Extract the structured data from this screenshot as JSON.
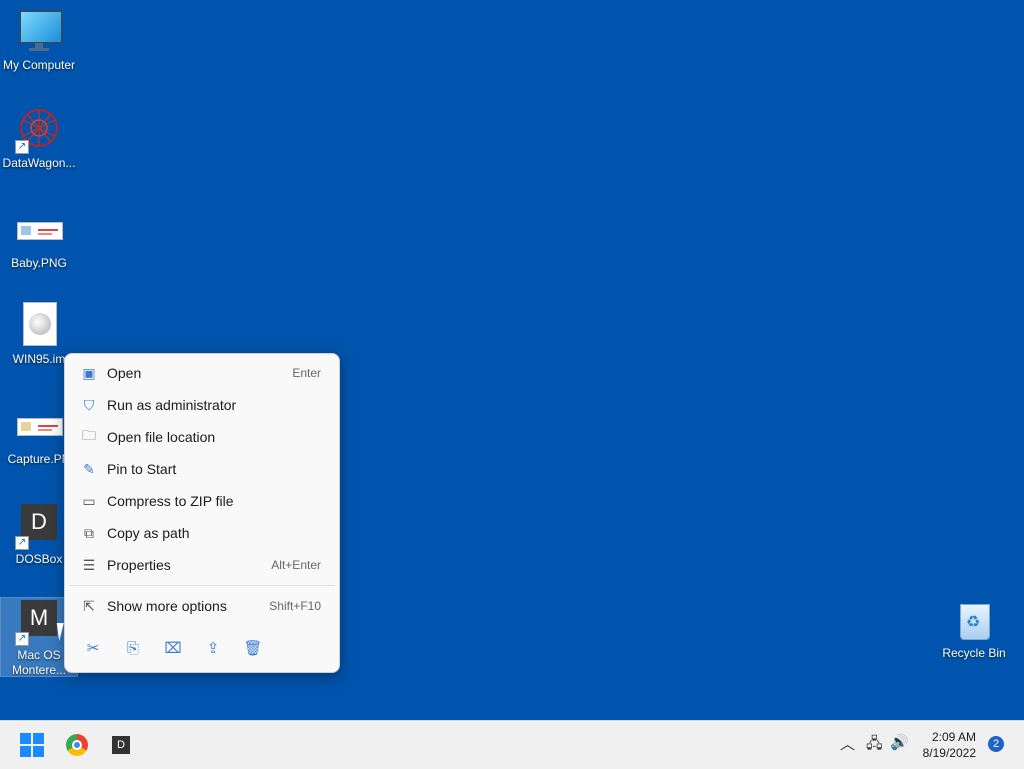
{
  "desktop": {
    "icons": [
      {
        "label": "My Computer",
        "icon": "monitor-icon"
      },
      {
        "label": "DataWagon...",
        "icon": "datawagon-icon"
      },
      {
        "label": "Baby.PNG",
        "icon": "png-file-icon"
      },
      {
        "label": "WIN95.im",
        "icon": "disc-image-icon"
      },
      {
        "label": "Capture.PN",
        "icon": "png-file-icon"
      },
      {
        "label": "DOSBox",
        "icon": "dosbox-icon",
        "tile_letter": "D"
      },
      {
        "label_line1": "Mac OS",
        "label_line2": "Montere...",
        "icon": "macos-icon",
        "tile_letter": "M"
      },
      {
        "label": "Recycle Bin",
        "icon": "recycle-bin-icon"
      }
    ]
  },
  "context_menu": {
    "items": [
      {
        "label": "Open",
        "shortcut": "Enter",
        "icon": "open-icon"
      },
      {
        "label": "Run as administrator",
        "shortcut": "",
        "icon": "shield-admin-icon"
      },
      {
        "label": "Open file location",
        "shortcut": "",
        "icon": "folder-icon"
      },
      {
        "label": "Pin to Start",
        "shortcut": "",
        "icon": "pin-icon"
      },
      {
        "label": "Compress to ZIP file",
        "shortcut": "",
        "icon": "zip-icon"
      },
      {
        "label": "Copy as path",
        "shortcut": "",
        "icon": "copy-path-icon"
      },
      {
        "label": "Properties",
        "shortcut": "Alt+Enter",
        "icon": "properties-icon"
      },
      {
        "label": "Show more options",
        "shortcut": "Shift+F10",
        "icon": "more-options-icon"
      }
    ],
    "actions": [
      "cut-icon",
      "copy-icon",
      "rename-icon",
      "share-icon",
      "delete-icon"
    ]
  },
  "taskbar": {
    "apps": [
      "start-icon",
      "chrome-icon",
      "dosbox-icon"
    ],
    "dos_letter": "D",
    "clock_time": "2:09 AM",
    "clock_date": "8/19/2022",
    "notification_count": "2"
  }
}
